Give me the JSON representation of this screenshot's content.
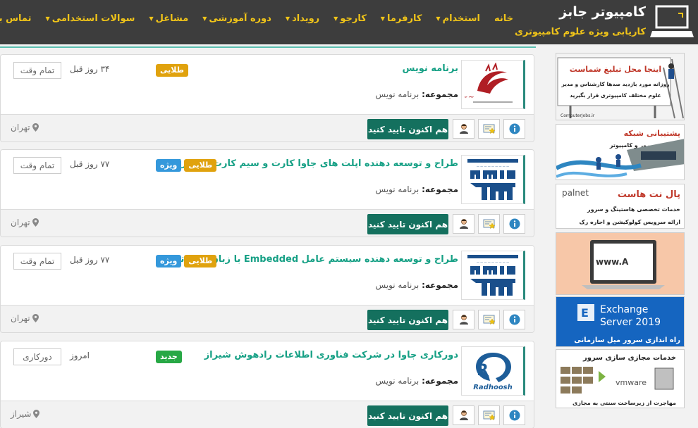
{
  "brand": {
    "title": "کامپیوتر جابز",
    "subtitle": "کاریابی ویژه علوم کامپیوتری"
  },
  "nav": [
    {
      "label": "خانه",
      "caret": false
    },
    {
      "label": "استخدام",
      "caret": true
    },
    {
      "label": "کارفرما",
      "caret": true
    },
    {
      "label": "کارجو",
      "caret": true
    },
    {
      "label": "رویداد",
      "caret": true
    },
    {
      "label": "دوره آموزشی",
      "caret": true
    },
    {
      "label": "مشاغل",
      "caret": true
    },
    {
      "label": "سوالات استخدامی",
      "caret": true
    },
    {
      "label": "تماس با ما",
      "caret": true
    }
  ],
  "common": {
    "category_label": "مجموعه:",
    "confirm_label": "هم اکنون تایید کنید"
  },
  "jobs": [
    {
      "title": "برنامه نویس",
      "badges": [
        {
          "label": "طلایی",
          "color": "#e0a20e"
        }
      ],
      "ago": "۳۴ روز قبل",
      "type": "تمام وقت",
      "category": "برنامه نویس",
      "location": "تهران",
      "logo": "mojtame-logo"
    },
    {
      "title": "طراح و توسعه دهنده اپلت های جاوا کارت و سیم کارت در تهران",
      "badges": [
        {
          "label": "ویژه",
          "color": "#3498db"
        },
        {
          "label": "طلایی",
          "color": "#e0a20e"
        }
      ],
      "ago": "۷۷ روز قبل",
      "type": "تمام وقت",
      "category": "برنامه نویس",
      "location": "تهران",
      "logo": "amin-logo"
    },
    {
      "title": "طراح و توسعه دهنده سیستم عامل Embedded با زبان C در تهران",
      "badges": [
        {
          "label": "ویژه",
          "color": "#3498db"
        },
        {
          "label": "طلایی",
          "color": "#e0a20e"
        }
      ],
      "ago": "۷۷ روز قبل",
      "type": "تمام وقت",
      "category": "برنامه نویس",
      "location": "تهران",
      "logo": "amin-logo"
    },
    {
      "title": "دورکاری جاوا در شرکت فناوری اطلاعات رادهوش شیراز",
      "badges": [
        {
          "label": "جدید",
          "color": "#27a845"
        }
      ],
      "ago": "امروز",
      "type": "دورکاری",
      "category": "برنامه نویس",
      "location": "شیراز",
      "logo": "radhoosh-logo",
      "logo_text": "Radhoosh"
    }
  ],
  "ads": {
    "ad1": {
      "headline": "اینجا محل تبلیغ شماست",
      "line1": "روزانه مورد بازدید صدها کارشناس و مدیر",
      "line2": "علوم مختلف کامپیوتری قرار بگیرید",
      "footer": "ComputerJobs.ir"
    },
    "ad2": {
      "headline": "پشتیبانی شبکه",
      "line1": "نگهداری سرور و کامپیوتر"
    },
    "ad3": {
      "brand": "palnet",
      "headline": "پال نت هاست",
      "line1": "خدمات تخصصی هاستینگ و سرور",
      "line2": "ارائه سرویس کولوکیشن و اجاره رک"
    },
    "ad4": {
      "screen_text": "www.A"
    },
    "ad5": {
      "line1": "Exchange",
      "line2": "Server 2019",
      "line3": "راه اندازی سرور میل سازمانی"
    },
    "ad6": {
      "headline": "خدمات مجازی سازی سرور",
      "brand": "vmware",
      "footer": "مهاجرت از زیرساخت سنتی به مجازی"
    }
  }
}
